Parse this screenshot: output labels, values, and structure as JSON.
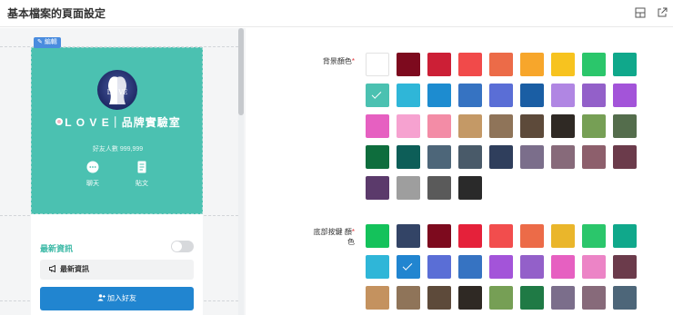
{
  "header": {
    "title": "基本檔案的頁面設定",
    "icons": [
      "expand-icon",
      "external-link-icon"
    ]
  },
  "preview": {
    "edit_badge": "編輯",
    "shop_name": "L O V E｜品牌實驗室",
    "avatar_text": "LO VE",
    "followers": "好友人數 999,999",
    "actions": [
      {
        "label": "聊天",
        "icon": "chat-icon"
      },
      {
        "label": "貼文",
        "icon": "post-icon"
      }
    ],
    "section_title": "最新資訊",
    "toggle_on": false,
    "news_label": "最新資訊",
    "add_friend_label": "加入好友",
    "colors": {
      "cover": "#4bc1b1",
      "section_title": "#3cb9a6",
      "button": "#2185d0"
    }
  },
  "settings": {
    "background_color": {
      "label": "背景顏色",
      "required": "*",
      "selected": "#4bc1b1",
      "colors": [
        "#ffffff",
        "#7d0a1e",
        "#cc1f36",
        "#f14a4a",
        "#ec6b48",
        "#f7a62b",
        "#f7c31f",
        "#2bc66b",
        "#10a88b",
        "#4bc1b1",
        "#2fb6d8",
        "#1d8cd0",
        "#3673c2",
        "#5a6ed6",
        "#1a5ea4",
        "#b086e3",
        "#9360c9",
        "#a354d9",
        "#e660c1",
        "#f6a2d0",
        "#f38ca6",
        "#c49966",
        "#8f7459",
        "#5d4a3a",
        "#2f2924",
        "#769f55",
        "#546d4c",
        "#0e6d3d",
        "#0d5e58",
        "#4d6679",
        "#495a69",
        "#2f3e5c",
        "#7b6e8b",
        "#876a7a",
        "#8d5f6c",
        "#6b3b4b",
        "#5b3a6b",
        "#9e9e9e",
        "#5a5a5a",
        "#2a2a2a"
      ]
    },
    "button_color": {
      "label_line1": "底部按鍵 顏",
      "label_line2": "色",
      "required": "*",
      "selected": "#2185d0",
      "colors": [
        "#14c25b",
        "#334466",
        "#7d0a1e",
        "#e5213a",
        "#f24d4d",
        "#ec6b48",
        "#eab62b",
        "#2bc66b",
        "#10a88b",
        "#2fb6d8",
        "#2185d0",
        "#5a6ed6",
        "#3673c2",
        "#a354d9",
        "#9360c9",
        "#e660c1",
        "#ec84c6",
        "#6b3b4b",
        "#c4925f",
        "#8f7459",
        "#5d4a3a",
        "#2f2924",
        "#769f55",
        "#1f7a45",
        "#7b6e8b",
        "#876a7a",
        "#4d6679"
      ]
    }
  }
}
